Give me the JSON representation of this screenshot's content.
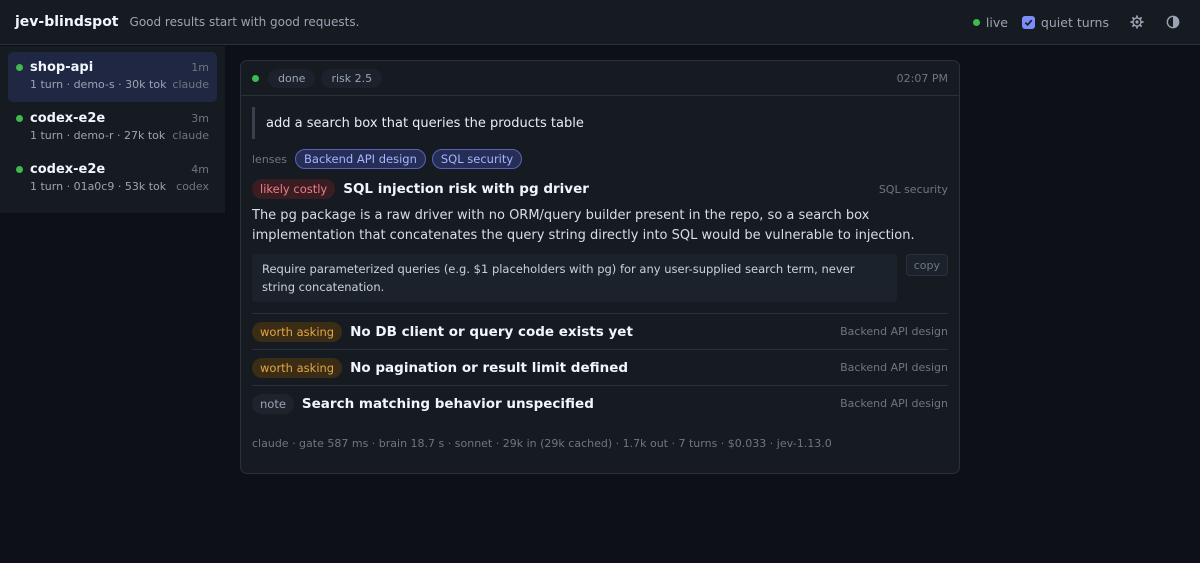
{
  "app": {
    "brand": "jev-blindspot",
    "tagline": "Good results start with good requests.",
    "live_label": "live",
    "quiet_turns_label": "quiet turns",
    "quiet_turns_checked": true
  },
  "sessions": [
    {
      "name": "shop-api",
      "age": "1m",
      "meta": "1 turn · demo-s · 30k tok",
      "agent": "claude",
      "active": true
    },
    {
      "name": "codex-e2e",
      "age": "3m",
      "meta": "1 turn · demo-r · 27k tok",
      "agent": "claude",
      "active": false
    },
    {
      "name": "codex-e2e",
      "age": "4m",
      "meta": "1 turn · 01a0c9 · 53k tok",
      "agent": "codex",
      "active": false
    }
  ],
  "turn": {
    "status": "done",
    "risk": "risk 2.5",
    "time": "02:07 PM",
    "prompt": "add a search box that queries the products table",
    "lenses_label": "lenses",
    "lenses": [
      "Backend API design",
      "SQL security"
    ],
    "main_finding": {
      "severity": "likely costly",
      "title": "SQL injection risk with pg driver",
      "lens": "SQL security",
      "body": "The pg package is a raw driver with no ORM/query builder present in the repo, so a search box implementation that concatenates the query string directly into SQL would be vulnerable to injection.",
      "suggestion": "Require parameterized queries (e.g. $1 placeholders with pg) for any user-supplied search term, never string concatenation.",
      "copy_label": "copy"
    },
    "findings": [
      {
        "severity": "worth asking",
        "title": "No DB client or query code exists yet",
        "lens": "Backend API design"
      },
      {
        "severity": "worth asking",
        "title": "No pagination or result limit defined",
        "lens": "Backend API design"
      },
      {
        "severity": "note",
        "title": "Search matching behavior unspecified",
        "lens": "Backend API design"
      }
    ],
    "footer": "claude · gate 587 ms · brain 18.7 s · sonnet · 29k in (29k cached) · 1.7k out · 7 turns · $0.033 · jev-1.13.0"
  },
  "colors": {
    "live": "#3fb950",
    "accent": "#7c8cf8",
    "costly": "#f07d85",
    "asking": "#e3a644"
  },
  "icons": {
    "settings": "gear-icon",
    "theme": "contrast-icon",
    "checkbox": "check-icon"
  }
}
